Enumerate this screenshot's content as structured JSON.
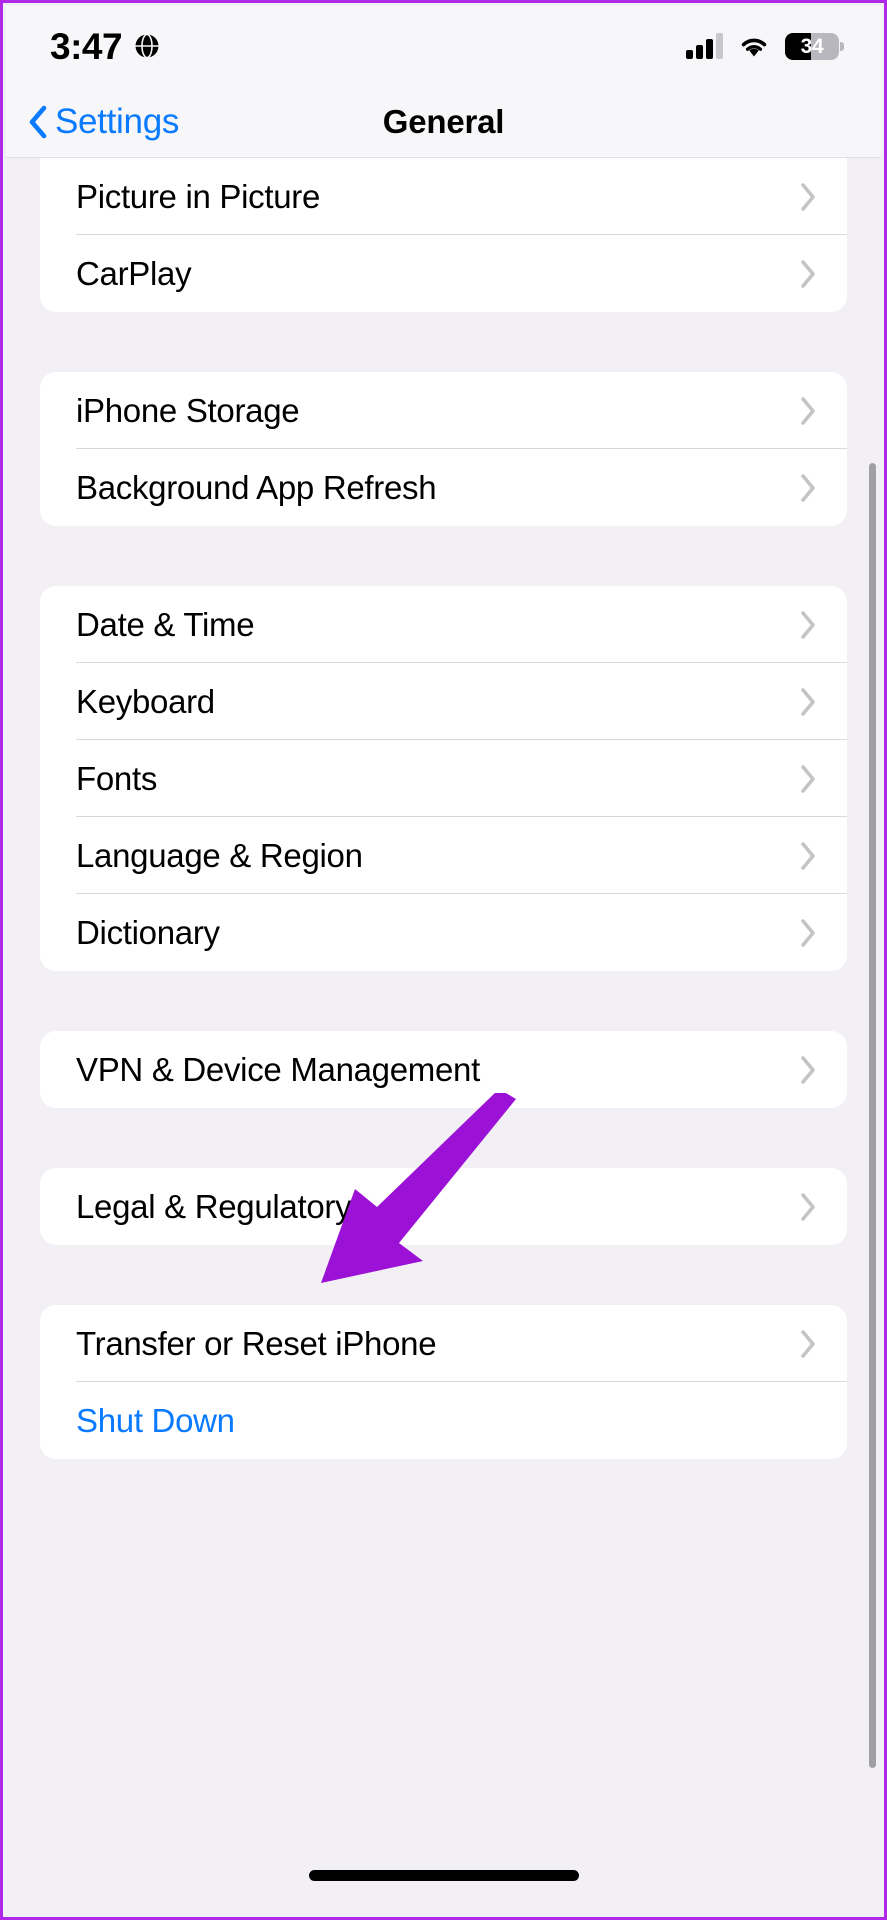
{
  "theme": {
    "background": "#f2f0f5",
    "card": "#ffffff",
    "accent_blue": "#0a7aff",
    "separator": "#d9d8dc",
    "chevron": "#c4c4c6",
    "annotation_purple": "#9b11d6",
    "frame_border": "#b028e8"
  },
  "status_bar": {
    "time": "3:47",
    "location_icon": "globe-icon",
    "cellular_icon": "cellular-signal-icon",
    "wifi_icon": "wifi-icon",
    "battery_icon": "battery-icon",
    "battery_percent": "34"
  },
  "nav_bar": {
    "back_icon": "chevron-left-icon",
    "back_label": "Settings",
    "title": "General"
  },
  "groups": [
    {
      "id": "group-media",
      "clipped_top": true,
      "rows": [
        {
          "label": "Picture in Picture",
          "accessory": "chevron-right-icon",
          "style": "default"
        },
        {
          "label": "CarPlay",
          "accessory": "chevron-right-icon",
          "style": "default"
        }
      ]
    },
    {
      "id": "group-storage",
      "clipped_top": false,
      "rows": [
        {
          "label": "iPhone Storage",
          "accessory": "chevron-right-icon",
          "style": "default"
        },
        {
          "label": "Background App Refresh",
          "accessory": "chevron-right-icon",
          "style": "default"
        }
      ]
    },
    {
      "id": "group-locale",
      "clipped_top": false,
      "rows": [
        {
          "label": "Date & Time",
          "accessory": "chevron-right-icon",
          "style": "default"
        },
        {
          "label": "Keyboard",
          "accessory": "chevron-right-icon",
          "style": "default"
        },
        {
          "label": "Fonts",
          "accessory": "chevron-right-icon",
          "style": "default"
        },
        {
          "label": "Language & Region",
          "accessory": "chevron-right-icon",
          "style": "default"
        },
        {
          "label": "Dictionary",
          "accessory": "chevron-right-icon",
          "style": "default"
        }
      ]
    },
    {
      "id": "group-vpn",
      "clipped_top": false,
      "rows": [
        {
          "label": "VPN & Device Management",
          "accessory": "chevron-right-icon",
          "style": "default"
        }
      ]
    },
    {
      "id": "group-legal",
      "clipped_top": false,
      "rows": [
        {
          "label": "Legal & Regulatory",
          "accessory": "chevron-right-icon",
          "style": "default"
        }
      ]
    },
    {
      "id": "group-reset",
      "clipped_top": false,
      "rows": [
        {
          "label": "Transfer or Reset iPhone",
          "accessory": "chevron-right-icon",
          "style": "default"
        },
        {
          "label": "Shut Down",
          "accessory": "none",
          "style": "accent"
        }
      ]
    }
  ],
  "annotation": {
    "type": "arrow",
    "color": "#9b11d6",
    "points_to": "Transfer or Reset iPhone",
    "direction": "down-left"
  },
  "scrollbar": {
    "visible": true
  },
  "home_indicator": {
    "visible": true
  }
}
